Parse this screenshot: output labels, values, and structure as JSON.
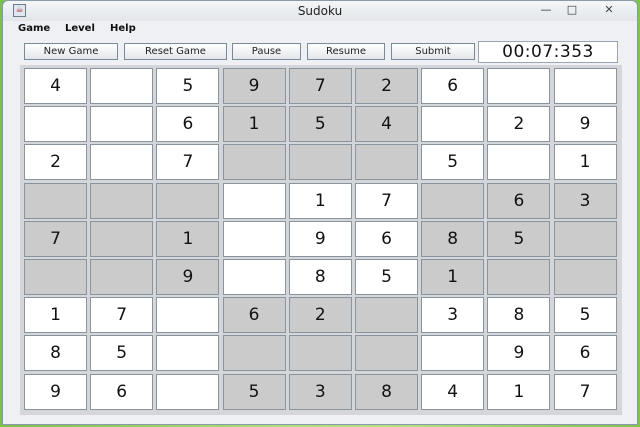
{
  "window": {
    "title": "Sudoku",
    "app_icon": "java-cup-icon"
  },
  "window_controls": {
    "minimize": "—",
    "maximize": "□",
    "close": "✕"
  },
  "menu": [
    "Game",
    "Level",
    "Help"
  ],
  "toolbar": {
    "new_game": "New Game",
    "reset_game": "Reset Game",
    "pause": "Pause",
    "resume": "Resume",
    "submit": "Submit",
    "timer": "00:07:353"
  },
  "colors": {
    "shaded_cell": "#cbcbcb",
    "plain_cell": "#ffffff",
    "desktop": "#9fd46c"
  },
  "board": {
    "values": [
      [
        "4",
        "",
        "5",
        "9",
        "7",
        "2",
        "6",
        "",
        ""
      ],
      [
        "",
        "",
        "6",
        "1",
        "5",
        "4",
        "",
        "2",
        "9"
      ],
      [
        "2",
        "",
        "7",
        "",
        "",
        "",
        "5",
        "",
        "1"
      ],
      [
        "",
        "",
        "",
        "",
        "1",
        "7",
        "",
        "6",
        "3"
      ],
      [
        "7",
        "",
        "1",
        "",
        "9",
        "6",
        "8",
        "5",
        ""
      ],
      [
        "",
        "",
        "9",
        "",
        "8",
        "5",
        "1",
        "",
        ""
      ],
      [
        "1",
        "7",
        "",
        "6",
        "2",
        "",
        "3",
        "8",
        "5"
      ],
      [
        "8",
        "5",
        "",
        "",
        "",
        "",
        "",
        "9",
        "6"
      ],
      [
        "9",
        "6",
        "",
        "5",
        "3",
        "8",
        "4",
        "1",
        "7"
      ]
    ],
    "shaded": [
      [
        0,
        0,
        0,
        1,
        1,
        1,
        0,
        0,
        0
      ],
      [
        0,
        0,
        0,
        1,
        1,
        1,
        0,
        0,
        0
      ],
      [
        0,
        0,
        0,
        1,
        1,
        1,
        0,
        0,
        0
      ],
      [
        1,
        1,
        1,
        0,
        0,
        0,
        1,
        1,
        1
      ],
      [
        1,
        1,
        1,
        0,
        0,
        0,
        1,
        1,
        1
      ],
      [
        1,
        1,
        1,
        0,
        0,
        0,
        1,
        1,
        1
      ],
      [
        0,
        0,
        0,
        1,
        1,
        1,
        0,
        0,
        0
      ],
      [
        0,
        0,
        0,
        1,
        1,
        1,
        0,
        0,
        0
      ],
      [
        0,
        0,
        0,
        1,
        1,
        1,
        0,
        0,
        0
      ]
    ]
  }
}
